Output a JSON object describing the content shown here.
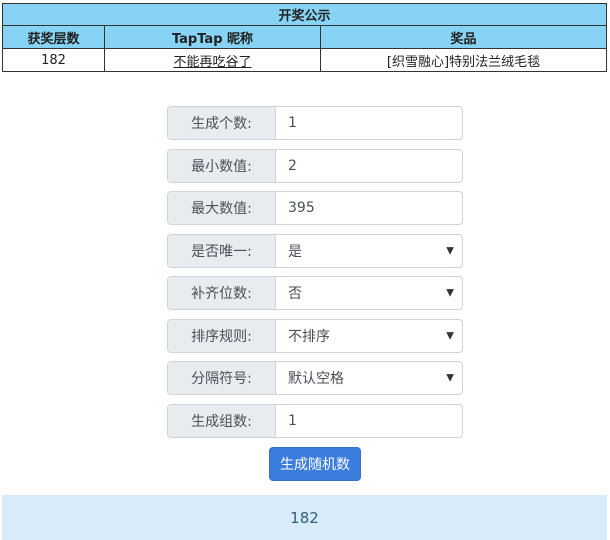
{
  "table": {
    "caption": "开奖公示",
    "headers": [
      "获奖层数",
      "TapTap 昵称",
      "奖品"
    ],
    "rows": [
      {
        "floor": "182",
        "nickname": "不能再吃谷了",
        "prize": "[织雪融心]特别法兰绒毛毯"
      }
    ]
  },
  "form": {
    "fields": [
      {
        "label": "生成个数:",
        "value": "1",
        "type": "input"
      },
      {
        "label": "最小数值:",
        "value": "2",
        "type": "input"
      },
      {
        "label": "最大数值:",
        "value": "395",
        "type": "input"
      },
      {
        "label": "是否唯一:",
        "value": "是",
        "type": "select"
      },
      {
        "label": "补齐位数:",
        "value": "否",
        "type": "select"
      },
      {
        "label": "排序规则:",
        "value": "不排序",
        "type": "select"
      },
      {
        "label": "分隔符号:",
        "value": "默认空格",
        "type": "select"
      },
      {
        "label": "生成组数:",
        "value": "1",
        "type": "input"
      }
    ],
    "generate_label": "生成随机数"
  },
  "result": {
    "value": "182"
  },
  "icons": {
    "select_arrow": "chevron-down-icon"
  }
}
